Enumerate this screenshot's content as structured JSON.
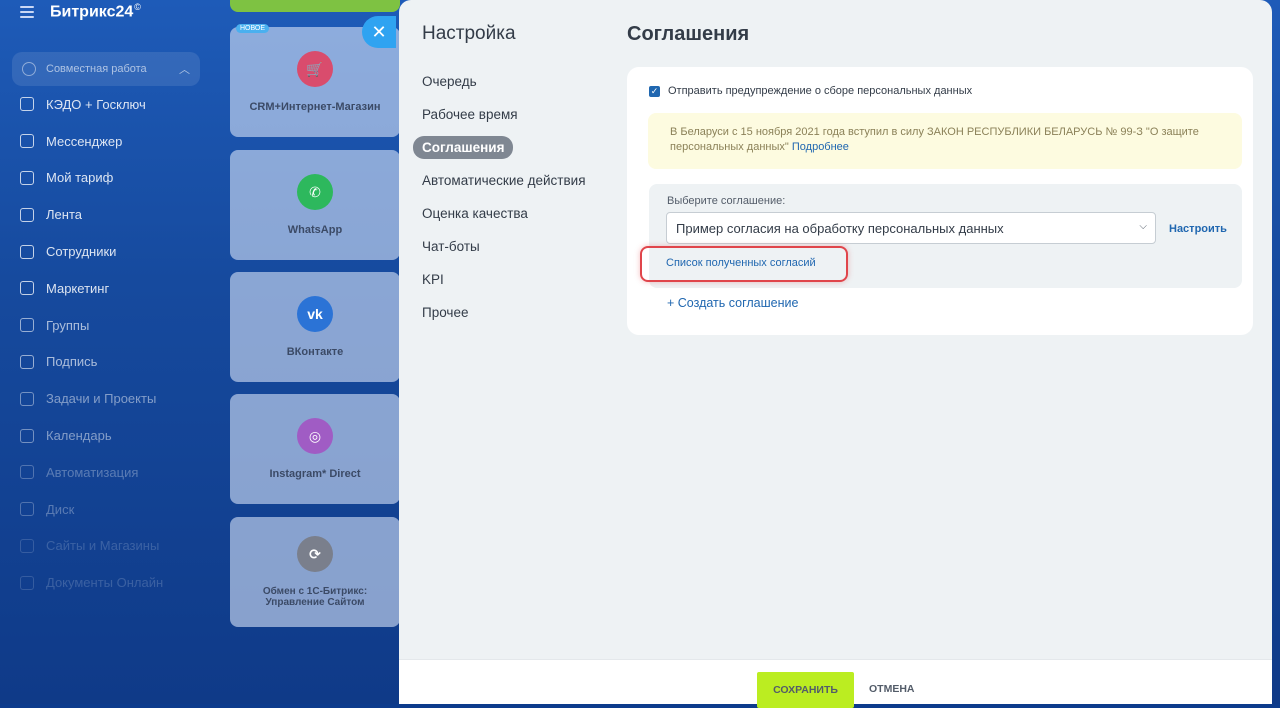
{
  "app": {
    "brand": "Битрикс24",
    "brand_mark": "©"
  },
  "sidebar": {
    "group_label": "Совместная работа",
    "items": [
      {
        "label": "КЭДО + Госключ"
      },
      {
        "label": "Мессенджер"
      },
      {
        "label": "Мой тариф"
      },
      {
        "label": "Лента"
      },
      {
        "label": "Сотрудники"
      },
      {
        "label": "Маркетинг"
      },
      {
        "label": "Группы"
      },
      {
        "label": "Подпись"
      },
      {
        "label": "Задачи и Проекты"
      },
      {
        "label": "Календарь"
      },
      {
        "label": "Автоматизация"
      },
      {
        "label": "Диск"
      },
      {
        "label": "Сайты и Магазины"
      },
      {
        "label": "Документы Онлайн"
      }
    ]
  },
  "tiles": {
    "new_badge": "НОВОЕ",
    "items": [
      {
        "label": "CRM+Интернет-Магазин",
        "icon": "cart-icon",
        "color": "#d94c6d"
      },
      {
        "label": "WhatsApp",
        "icon": "whatsapp-icon",
        "color": "#2db85d"
      },
      {
        "label": "ВКонтакте",
        "icon": "vk-icon",
        "color": "#2b73d6"
      },
      {
        "label": "Instagram* Direct",
        "icon": "instagram-icon",
        "color": "#a05cc4"
      },
      {
        "label": "Обмен с 1С-Битрикс: Управление Сайтом",
        "icon": "exchange-icon",
        "color": "#7a7f8c"
      }
    ]
  },
  "panel": {
    "settings_title": "Настройка",
    "menu": [
      {
        "label": "Очередь"
      },
      {
        "label": "Рабочее время"
      },
      {
        "label": "Соглашения",
        "active": true
      },
      {
        "label": "Автоматические действия"
      },
      {
        "label": "Оценка качества"
      },
      {
        "label": "Чат-боты"
      },
      {
        "label": "KPI"
      },
      {
        "label": "Прочее"
      }
    ],
    "page_title": "Соглашения",
    "checkbox_label": "Отправить предупреждение о сборе персональных данных",
    "checkbox_checked": true,
    "notice_text": "В Беларуси с 15 ноября 2021 года вступил в силу ЗАКОН РЕСПУБЛИКИ БЕЛАРУСЬ № 99-З \"О защите персональных данных\"",
    "notice_link": "Подробнее",
    "select_label": "Выберите соглашение:",
    "select_value": "Пример согласия на обработку персональных данных",
    "configure_link": "Настроить",
    "consents_link": "Список полученных согласий",
    "create_link": "+ Создать соглашение",
    "save_label": "СОХРАНИТЬ",
    "cancel_label": "ОТМЕНА"
  },
  "colors": {
    "accent_blue": "#2067b0",
    "save_green": "#bbed21",
    "highlight_red": "#e0454b",
    "notice_bg": "#fdfbe0"
  }
}
